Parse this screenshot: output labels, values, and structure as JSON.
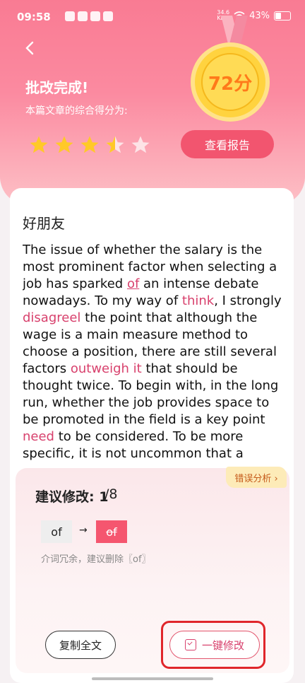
{
  "status_bar": {
    "time": "09:58",
    "net_speed": "34.6",
    "net_speed_unit": "KB/s",
    "battery": "43%"
  },
  "header": {
    "title": "批改完成!",
    "subtitle": "本篇文章的综合得分为:",
    "score": "72分",
    "rating_stars": 3.5,
    "report_button": "查看报告"
  },
  "essay": {
    "title": "好朋友",
    "segments": [
      {
        "t": "The issue of whether the salary is the most prominent factor when selecting a job has sparked ",
        "c": ""
      },
      {
        "t": "of",
        "c": "hl ul"
      },
      {
        "t": " an intense debate nowadays. To my way of ",
        "c": ""
      },
      {
        "t": "think",
        "c": "hl"
      },
      {
        "t": ", I strongly ",
        "c": ""
      },
      {
        "t": "disagreel",
        "c": "hl"
      },
      {
        "t": " the point that although the wage is a main measure method to choose a position, there are still several factors ",
        "c": ""
      },
      {
        "t": "outweigh it",
        "c": "hl"
      },
      {
        "t": " that should be thought twice. To begin with, in the long run, whether the job provides space to be promoted in the field is a key point ",
        "c": ""
      },
      {
        "t": "need",
        "c": "hl"
      },
      {
        "t": " to be considered. To be more specific, it is not uncommon that a",
        "c": ""
      }
    ]
  },
  "suggestion": {
    "error_tab": "错误分析 ›",
    "label": "建议修改: 1",
    "count": "/8",
    "original": "of",
    "arrow": "→",
    "corrected": "of",
    "hint": "介词冗余，建议删除〖of〗",
    "copy_button": "复制全文",
    "fix_button": "一键修改"
  },
  "colors": {
    "accent": "#f2556f",
    "highlight": "#d8416d",
    "star": "#ffc928"
  }
}
